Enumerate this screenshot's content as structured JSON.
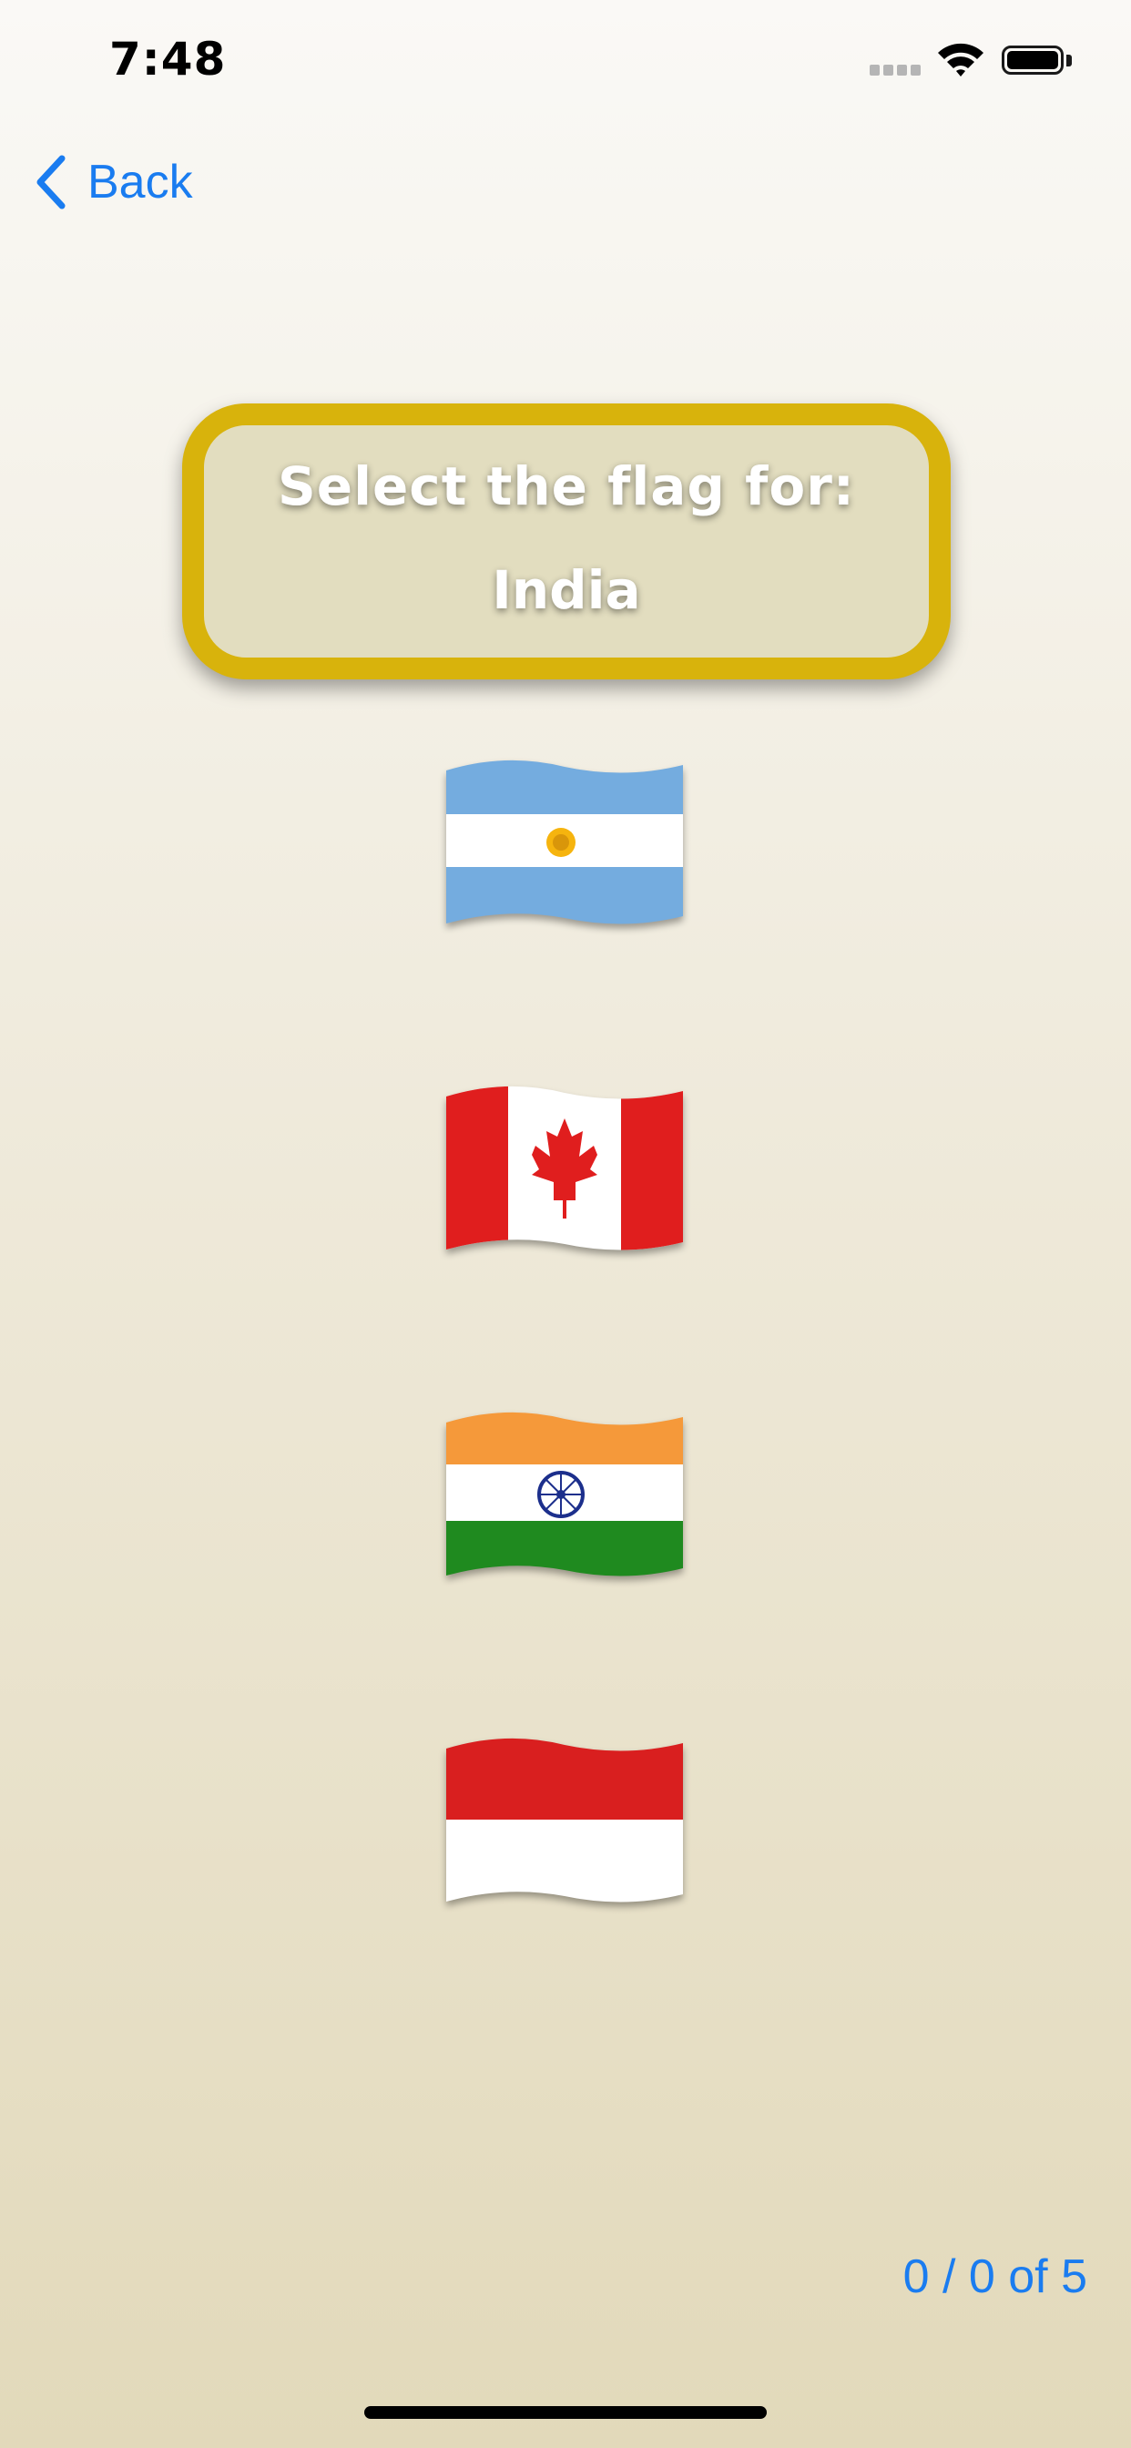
{
  "status_bar": {
    "time": "7:48",
    "signal_icon": "signal-bars-icon",
    "wifi_icon": "wifi-icon",
    "battery_icon": "battery-icon",
    "battery_level": 1.0
  },
  "nav": {
    "back_label": "Back",
    "back_icon": "chevron-left-icon",
    "accent_color": "#1a7cf0"
  },
  "prompt": {
    "title": "Select the flag for:",
    "country": "India",
    "border_color": "#d8b30c"
  },
  "flag_options": [
    {
      "country": "Argentina",
      "icon": "argentina-flag-icon"
    },
    {
      "country": "Canada",
      "icon": "canada-flag-icon"
    },
    {
      "country": "India",
      "icon": "india-flag-icon"
    },
    {
      "country": "Indonesia",
      "icon": "indonesia-flag-icon"
    }
  ],
  "score": {
    "text": "0 / 0 of 5"
  }
}
